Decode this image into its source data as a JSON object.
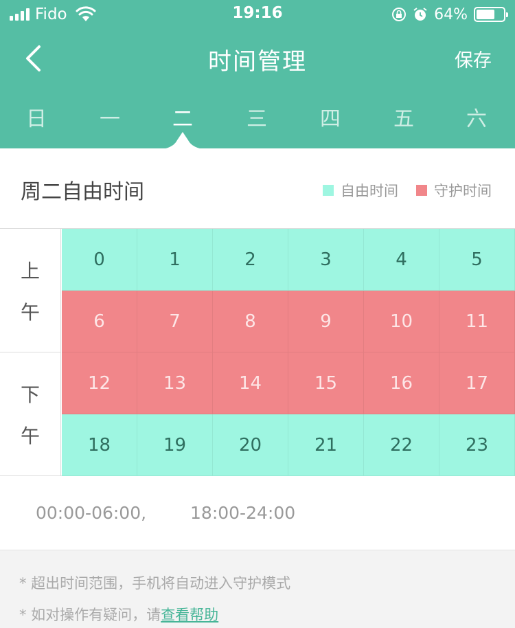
{
  "status_bar": {
    "carrier": "Fido",
    "time": "19:16",
    "battery": "64%"
  },
  "nav": {
    "title": "时间管理",
    "save_label": "保存"
  },
  "days": [
    {
      "label": "日"
    },
    {
      "label": "一"
    },
    {
      "label": "二"
    },
    {
      "label": "三"
    },
    {
      "label": "四"
    },
    {
      "label": "五"
    },
    {
      "label": "六"
    }
  ],
  "selected_day": "二",
  "section": {
    "title": "周二自由时间"
  },
  "legend": {
    "free": {
      "label": "自由时间",
      "color": "#9ef6e1"
    },
    "guard": {
      "label": "守护时间",
      "color": "#f1868a"
    }
  },
  "periods": {
    "am": [
      "上",
      "午"
    ],
    "pm": [
      "下",
      "午"
    ]
  },
  "hours": [
    {
      "hour": "0",
      "state": "free"
    },
    {
      "hour": "1",
      "state": "free"
    },
    {
      "hour": "2",
      "state": "free"
    },
    {
      "hour": "3",
      "state": "free"
    },
    {
      "hour": "4",
      "state": "free"
    },
    {
      "hour": "5",
      "state": "free"
    },
    {
      "hour": "6",
      "state": "guard"
    },
    {
      "hour": "7",
      "state": "guard"
    },
    {
      "hour": "8",
      "state": "guard"
    },
    {
      "hour": "9",
      "state": "guard"
    },
    {
      "hour": "10",
      "state": "guard"
    },
    {
      "hour": "11",
      "state": "guard"
    },
    {
      "hour": "12",
      "state": "guard"
    },
    {
      "hour": "13",
      "state": "guard"
    },
    {
      "hour": "14",
      "state": "guard"
    },
    {
      "hour": "15",
      "state": "guard"
    },
    {
      "hour": "16",
      "state": "guard"
    },
    {
      "hour": "17",
      "state": "guard"
    },
    {
      "hour": "18",
      "state": "free"
    },
    {
      "hour": "19",
      "state": "free"
    },
    {
      "hour": "20",
      "state": "free"
    },
    {
      "hour": "21",
      "state": "free"
    },
    {
      "hour": "22",
      "state": "free"
    },
    {
      "hour": "23",
      "state": "free"
    }
  ],
  "free_ranges": [
    "00:00-06:00,",
    "18:00-24:00"
  ],
  "notes": {
    "n1": "* 超出时间范围，手机将自动进入守护模式",
    "n2_prefix": "* 如对操作有疑问，请",
    "n2_link": "查看帮助"
  },
  "colors": {
    "header": "#55bea4",
    "free": "#9ef6e1",
    "guard": "#f1868a",
    "link": "#46b597"
  }
}
